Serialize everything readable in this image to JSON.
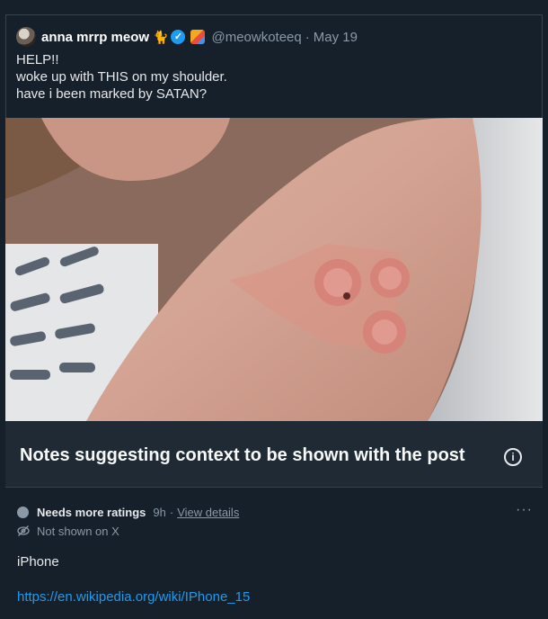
{
  "post": {
    "display_name": "anna mrrp meow",
    "name_emoji": "🐈",
    "handle": "@meowkoteeq",
    "separator": "·",
    "date": "May 19",
    "text_lines": [
      "HELP!!",
      "woke up with THIS on my shoulder.",
      "have i been marked by SATAN?"
    ],
    "verified_check": "✓"
  },
  "notes_banner": {
    "title": "Notes suggesting context to be shown with the post",
    "info_glyph": "i"
  },
  "note": {
    "status": "Needs more ratings",
    "time": "9h",
    "separator": "·",
    "view_details": "View details",
    "more_glyph": "···",
    "visibility": "Not shown on X",
    "body": "iPhone",
    "link": "https://en.wikipedia.org/wiki/IPhone_15"
  },
  "colors": {
    "background": "#15202b",
    "banner": "#1f2a35",
    "link": "#1d9bf0",
    "muted": "#8b98a5",
    "verified": "#1d9bf0"
  }
}
